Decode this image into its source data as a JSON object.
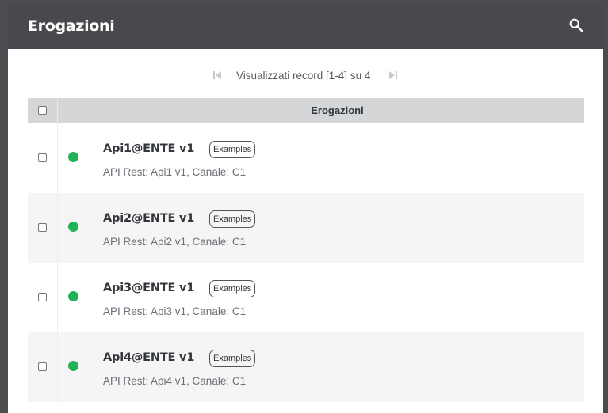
{
  "header": {
    "title": "Erogazioni",
    "search_icon": "search-icon"
  },
  "pager": {
    "status": "Visualizzati record [1-4] su 4",
    "first_icon": "first-page-icon",
    "last_icon": "last-page-icon"
  },
  "table": {
    "column_header": "Erogazioni",
    "rows": [
      {
        "name": "Api1@ENTE v1",
        "tag": "Examples",
        "description": "API Rest: Api1 v1, Canale: C1",
        "status_color": "#1fb256"
      },
      {
        "name": "Api2@ENTE v1",
        "tag": "Examples",
        "description": "API Rest: Api2 v1, Canale: C1",
        "status_color": "#1fb256"
      },
      {
        "name": "Api3@ENTE v1",
        "tag": "Examples",
        "description": "API Rest: Api3 v1, Canale: C1",
        "status_color": "#1fb256"
      },
      {
        "name": "Api4@ENTE v1",
        "tag": "Examples",
        "description": "API Rest: Api4 v1, Canale: C1",
        "status_color": "#1fb256"
      }
    ]
  },
  "colors": {
    "header_bg": "#47494d",
    "table_header_bg": "#d5d6d8",
    "status_active": "#1fb256"
  }
}
